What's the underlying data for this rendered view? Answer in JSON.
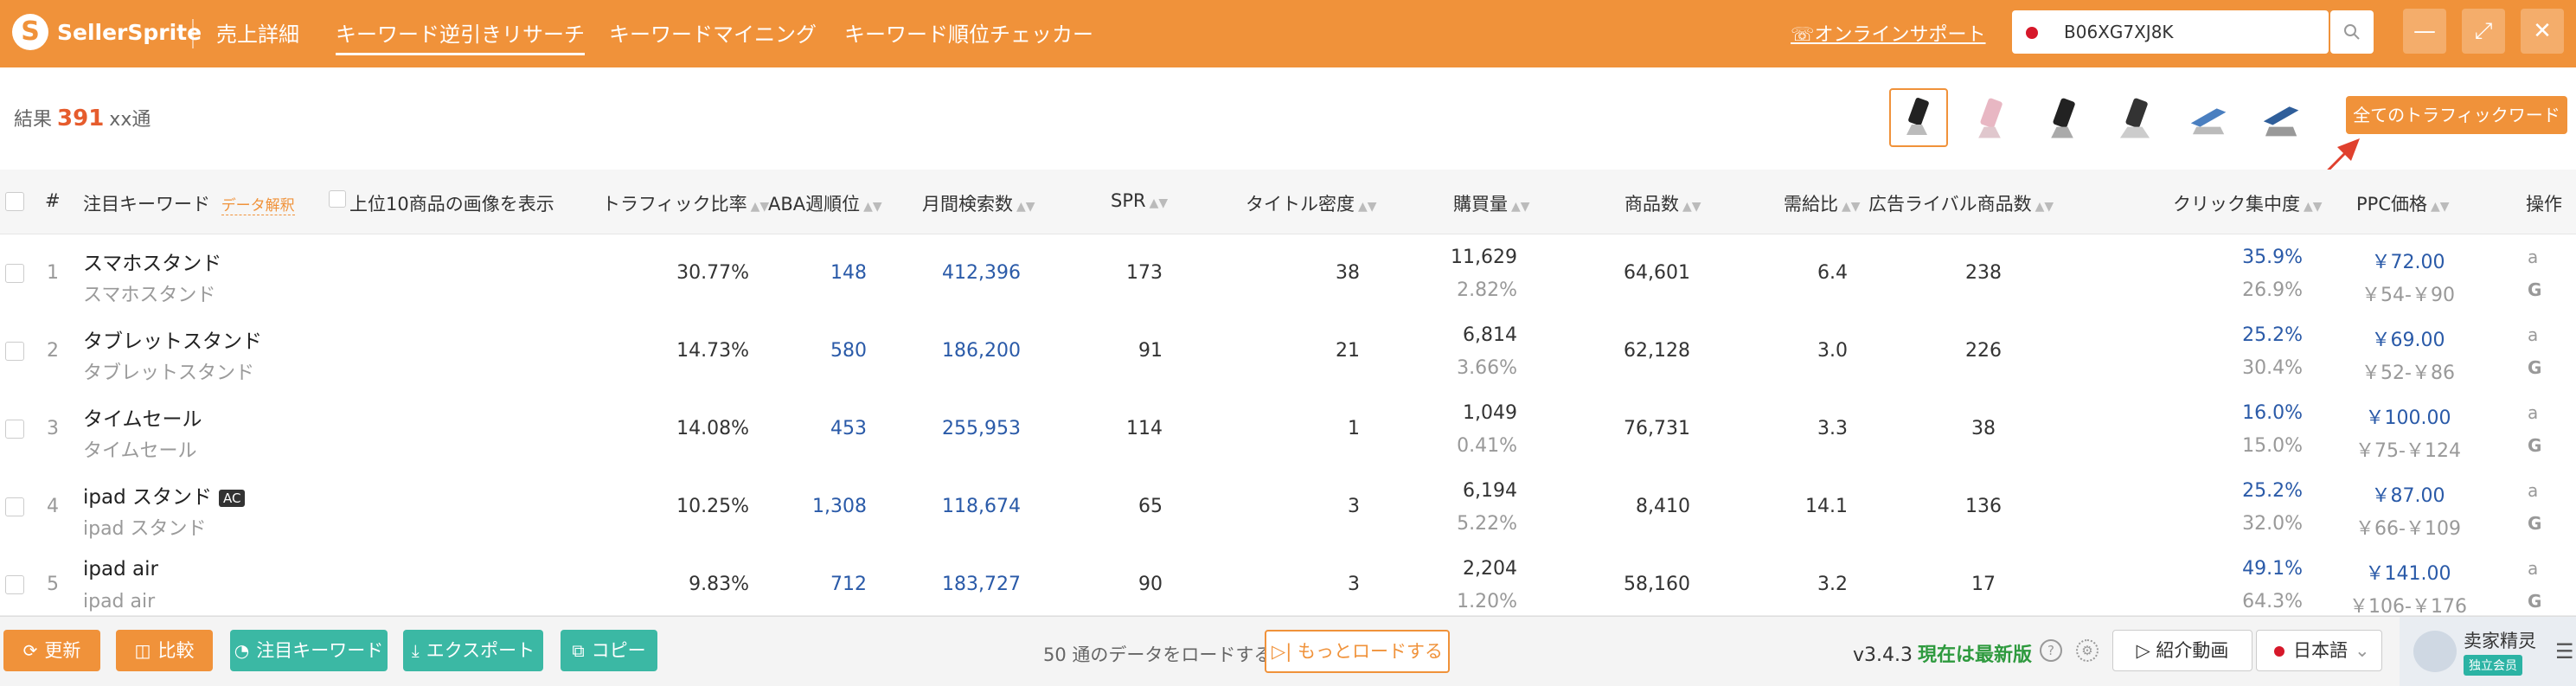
{
  "app": {
    "logo_text": "SellerSprite",
    "nav": [
      "売上詳細",
      "キーワード逆引きリサーチ",
      "キーワードマイニング",
      "キーワード順位チェッカー"
    ],
    "active_nav_index": 1,
    "support_link": "オンラインサポート",
    "search_value": "B06XG7XJ8K",
    "accent_color": "#f0923a",
    "window_icons": [
      "minimize-icon",
      "fullscreen-icon",
      "close-icon"
    ]
  },
  "result": {
    "prefix": "結果",
    "count": "391",
    "suffix": "xx通",
    "all_traffic_button": "全てのトラフィックワード"
  },
  "table": {
    "headers": {
      "index": "#",
      "keyword": "注目キーワード",
      "data_explain": "データ解釈",
      "show_images": "上位10商品の画像を表示",
      "traffic_ratio": "トラフィック比率",
      "aba_rank": "ABA週順位",
      "monthly_search": "月間検索数",
      "spr": "SPR",
      "title_density": "タイトル密度",
      "purchases": "購買量",
      "product_count": "商品数",
      "supply_demand": "需給比",
      "ad_competitors": "広告ライバル商品数",
      "click_concentration": "クリック集中度",
      "ppc_price": "PPC価格",
      "actions": "操作"
    },
    "rows": [
      {
        "index": "1",
        "keyword": "スマホスタンド",
        "translation": "スマホスタンド",
        "ac": false,
        "traffic_ratio": "30.77%",
        "aba_rank": "148",
        "monthly_search": "412,396",
        "spr": "173",
        "title_density": "38",
        "purchases": "11,629",
        "purchase_rate": "2.82%",
        "product_count": "64,601",
        "supply_demand": "6.4",
        "ad_competitors": "238",
        "click_concentration": "35.9%",
        "conversion_share": "26.9%",
        "ppc": "￥72.00",
        "ppc_range": "￥54-￥90"
      },
      {
        "index": "2",
        "keyword": "タブレットスタンド",
        "translation": "タブレットスタンド",
        "ac": false,
        "traffic_ratio": "14.73%",
        "aba_rank": "580",
        "monthly_search": "186,200",
        "spr": "91",
        "title_density": "21",
        "purchases": "6,814",
        "purchase_rate": "3.66%",
        "product_count": "62,128",
        "supply_demand": "3.0",
        "ad_competitors": "226",
        "click_concentration": "25.2%",
        "conversion_share": "30.4%",
        "ppc": "￥69.00",
        "ppc_range": "￥52-￥86"
      },
      {
        "index": "3",
        "keyword": "タイムセール",
        "translation": "タイムセール",
        "ac": false,
        "traffic_ratio": "14.08%",
        "aba_rank": "453",
        "monthly_search": "255,953",
        "spr": "114",
        "title_density": "1",
        "purchases": "1,049",
        "purchase_rate": "0.41%",
        "product_count": "76,731",
        "supply_demand": "3.3",
        "ad_competitors": "38",
        "click_concentration": "16.0%",
        "conversion_share": "15.0%",
        "ppc": "￥100.00",
        "ppc_range": "￥75-￥124"
      },
      {
        "index": "4",
        "keyword": "ipad スタンド",
        "translation": "ipad スタンド",
        "ac": true,
        "traffic_ratio": "10.25%",
        "aba_rank": "1,308",
        "monthly_search": "118,674",
        "spr": "65",
        "title_density": "3",
        "purchases": "6,194",
        "purchase_rate": "5.22%",
        "product_count": "8,410",
        "supply_demand": "14.1",
        "ad_competitors": "136",
        "click_concentration": "25.2%",
        "conversion_share": "32.0%",
        "ppc": "￥87.00",
        "ppc_range": "￥66-￥109"
      },
      {
        "index": "5",
        "keyword": "ipad air",
        "translation": "ipad air",
        "ac": false,
        "traffic_ratio": "9.83%",
        "aba_rank": "712",
        "monthly_search": "183,727",
        "spr": "90",
        "title_density": "3",
        "purchases": "2,204",
        "purchase_rate": "1.20%",
        "product_count": "58,160",
        "supply_demand": "3.2",
        "ad_competitors": "17",
        "click_concentration": "49.1%",
        "conversion_share": "64.3%",
        "ppc": "￥141.00",
        "ppc_range": "￥106-￥176"
      }
    ],
    "ac_label": "AC",
    "action_icons": [
      "amazon-icon",
      "google-icon"
    ]
  },
  "footer": {
    "buttons": [
      {
        "label": "更新",
        "icon": "refresh-icon",
        "color": "#f0923a"
      },
      {
        "label": "比較",
        "icon": "compare-icon",
        "color": "#f0923a"
      },
      {
        "label": "注目キーワード",
        "icon": "chart-icon",
        "color": "#3bb8a4"
      },
      {
        "label": "エクスポート",
        "icon": "download-icon",
        "color": "#3bb8a4"
      },
      {
        "label": "コピー",
        "icon": "copy-icon",
        "color": "#3bb8a4"
      }
    ],
    "load_text": "50 通のデータをロードする",
    "load_more": "もっとロードする",
    "version": "v3.4.3",
    "version_status": "現在は最新版",
    "video_button": "紹介動画",
    "language": "日本語",
    "profile_name": "卖家精灵",
    "profile_badge": "独立会员"
  }
}
